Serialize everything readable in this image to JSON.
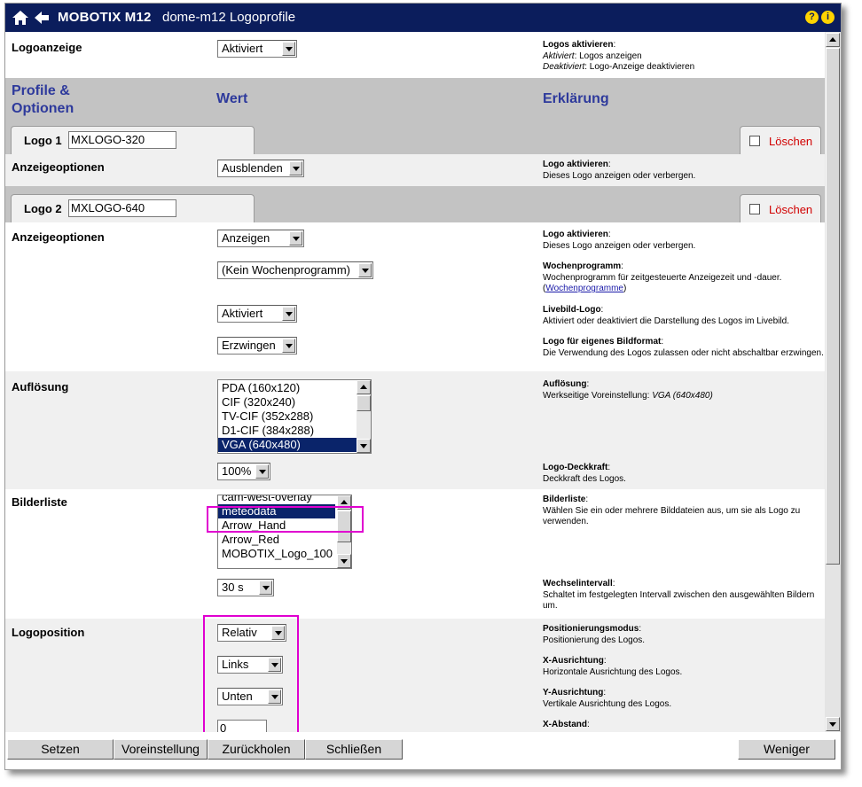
{
  "title": {
    "brand": "MOBOTIX M12",
    "page": "dome-m12 Logoprofile",
    "help_icon": "?",
    "info_icon": "i"
  },
  "logoanzeige": {
    "label": "Logoanzeige",
    "value": "Aktiviert",
    "desc_title": "Logos aktivieren",
    "desc_line1_i": "Aktiviert",
    "desc_line1": ": Logos anzeigen",
    "desc_line2_i": "Deaktiviert",
    "desc_line2": ": Logo-Anzeige deaktivieren"
  },
  "header": {
    "col1": "Profile &",
    "col1b": "Optionen",
    "col2": "Wert",
    "col3": "Erklärung"
  },
  "logo1": {
    "tab": "Logo 1",
    "name": "MXLOGO-320",
    "delete": "Löschen",
    "opt_label": "Anzeigeoptionen",
    "opt_value": "Ausblenden",
    "desc_title": "Logo aktivieren",
    "desc": "Dieses Logo anzeigen oder verbergen."
  },
  "logo2": {
    "tab": "Logo 2",
    "name": "MXLOGO-640",
    "delete": "Löschen",
    "opt_label": "Anzeigeoptionen",
    "anzeige_value": "Anzeigen",
    "anzeige_desc_title": "Logo aktivieren",
    "anzeige_desc": "Dieses Logo anzeigen oder verbergen.",
    "woche_value": "(Kein Wochenprogramm)",
    "woche_desc_title": "Wochenprogramm",
    "woche_desc": "Wochenprogramm für zeitgesteuerte Anzeigezeit und -dauer.",
    "woche_link": "Wochenprogramme",
    "live_value": "Aktiviert",
    "live_desc_title": "Livebild-Logo",
    "live_desc": "Aktiviert oder deaktiviert die Darstellung des Logos im Livebild.",
    "format_value": "Erzwingen",
    "format_desc_title": "Logo für eigenes Bildformat",
    "format_desc": "Die Verwendung des Logos zulassen oder nicht abschaltbar erzwingen.",
    "aufl_label": "Auflösung",
    "aufl_options": [
      "PDA (160x120)",
      "CIF (320x240)",
      "TV-CIF (352x288)",
      "D1-CIF (384x288)",
      "VGA (640x480)"
    ],
    "aufl_desc_title": "Auflösung",
    "aufl_desc": "Werkseitige Voreinstellung: ",
    "aufl_desc_i": "VGA (640x480)",
    "deck_value": "100%",
    "deck_desc_title": "Logo-Deckkraft",
    "deck_desc": "Deckkraft des Logos.",
    "bild_label": "Bilderliste",
    "bild_options": [
      "cam-west-overlay",
      "meteodata",
      "Arrow_Hand",
      "Arrow_Red",
      "MOBOTIX_Logo_100"
    ],
    "bild_desc_title": "Bilderliste",
    "bild_desc": "Wählen Sie ein oder mehrere Bilddateien aus, um sie als Logo zu verwenden.",
    "wechsel_value": "30 s",
    "wechsel_desc_title": "Wechselintervall",
    "wechsel_desc": "Schaltet im festgelegten Intervall zwischen den ausgewählten Bildern um.",
    "pos_label": "Logoposition",
    "pos_value": "Relativ",
    "pos_desc_title": "Positionierungsmodus",
    "pos_desc": "Positionierung des Logos.",
    "x_value": "Links",
    "x_desc_title": "X-Ausrichtung",
    "x_desc": "Horizontale Ausrichtung des Logos.",
    "y_value": "Unten",
    "y_desc_title": "Y-Ausrichtung",
    "y_desc": "Vertikale Ausrichtung des Logos.",
    "xab_value": "0",
    "xab_desc_title": "X-Abstand"
  },
  "footer": {
    "setzen": "Setzen",
    "voreinstellung": "Voreinstellung",
    "zurueck": "Zurückholen",
    "schliessen": "Schließen",
    "weniger": "Weniger"
  }
}
